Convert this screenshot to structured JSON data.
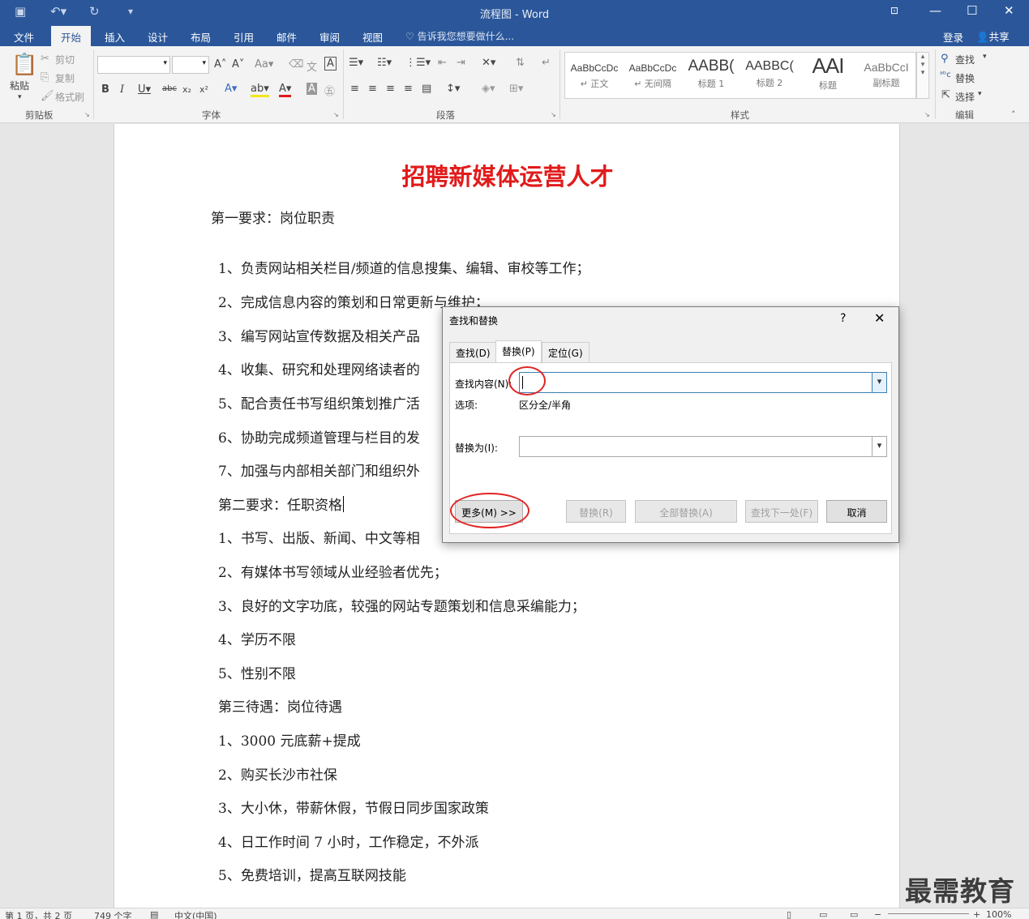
{
  "titlebar": {
    "title": "流程图 - Word",
    "save_icon": "save-icon",
    "undo_icon": "undo-icon",
    "redo_icon": "redo-icon"
  },
  "ribbon_tabs": {
    "file": "文件",
    "home": "开始",
    "insert": "插入",
    "design": "设计",
    "layout": "布局",
    "references": "引用",
    "mailings": "邮件",
    "review": "审阅",
    "view": "视图",
    "tell_me": "告诉我您想要做什么...",
    "login": "登录",
    "share": "共享"
  },
  "clipboard": {
    "paste": "粘贴",
    "cut": "剪切",
    "copy": "复制",
    "format_painter": "格式刷",
    "group": "剪贴板"
  },
  "font_group": {
    "group": "字体"
  },
  "paragraph_group": {
    "group": "段落"
  },
  "styles": {
    "group": "样式",
    "items": [
      {
        "preview": "AaBbCcDc",
        "name": "↵ 正文"
      },
      {
        "preview": "AaBbCcDc",
        "name": "↵ 无间隔"
      },
      {
        "preview": "AABB(",
        "name": "标题 1"
      },
      {
        "preview": "AABBC(",
        "name": "标题 2"
      },
      {
        "preview": "AAI",
        "name": "标题"
      },
      {
        "preview": "AaBbCcI",
        "name": "副标题"
      }
    ]
  },
  "editing": {
    "find": "查找",
    "replace": "替换",
    "select": "选择",
    "group": "编辑"
  },
  "document": {
    "title": "招聘新媒体运营人才",
    "lines": [
      "第一要求：岗位职责",
      "1、负责网站相关栏目/频道的信息搜集、编辑、审校等工作；",
      "2、完成信息内容的策划和日常更新与维护；",
      "3、编写网站宣传数据及相关产品",
      "4、收集、研究和处理网络读者的",
      "5、配合责任书写组织策划推广活",
      "6、协助完成频道管理与栏目的发",
      "7、加强与内部相关部门和组织外",
      "第二要求：任职资格",
      "1、书写、出版、新闻、中文等相",
      "2、有媒体书写领域从业经验者优先；",
      "3、良好的文字功底，较强的网站专题策划和信息采编能力；",
      "4、学历不限",
      "5、性别不限",
      "第三待遇：岗位待遇",
      "1、3000 元底薪+提成",
      "2、购买长沙市社保",
      "3、大小休，带薪休假，节假日同步国家政策",
      "4、日工作时间 7 小时，工作稳定，不外派",
      "5、免费培训，提高互联网技能"
    ]
  },
  "dialog": {
    "title": "查找和替换",
    "help": "?",
    "tabs": {
      "find": "查找(D)",
      "replace": "替换(P)",
      "goto": "定位(G)"
    },
    "find_label": "查找内容(N):",
    "find_value": "",
    "options_label": "选项:",
    "options_value": "区分全/半角",
    "replace_label": "替换为(I):",
    "replace_value": "",
    "buttons": {
      "more": "更多(M) >>",
      "replace": "替换(R)",
      "replace_all": "全部替换(A)",
      "find_next": "查找下一处(F)",
      "cancel": "取消"
    }
  },
  "statusbar": {
    "page": "第 1 页，共 2 页",
    "words": "749 个字",
    "language": "中文(中国)",
    "zoom": "100%"
  },
  "watermark": "最需教育"
}
